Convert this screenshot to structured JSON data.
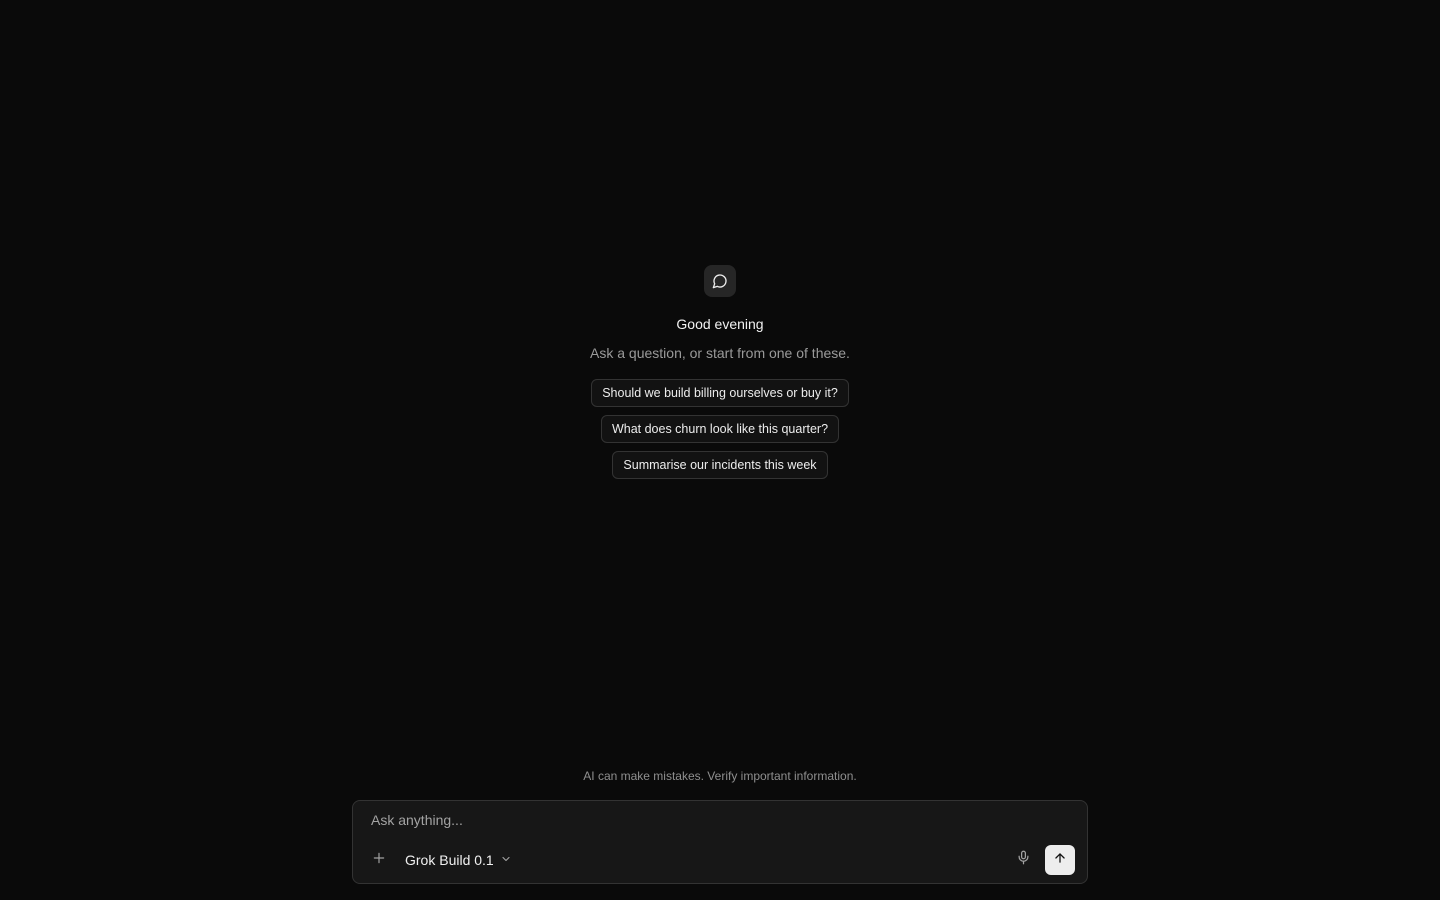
{
  "hero": {
    "icon": "chat-bubble-icon",
    "greeting": "Good evening",
    "subtitle": "Ask a question, or start from one of these."
  },
  "suggestions": [
    {
      "label": "Should we build billing ourselves or buy it?"
    },
    {
      "label": "What does churn look like this quarter?"
    },
    {
      "label": "Summarise our incidents this week"
    }
  ],
  "disclaimer": "AI can make mistakes. Verify important information.",
  "composer": {
    "placeholder": "Ask anything...",
    "value": "",
    "add_icon": "plus-icon",
    "model_label": "Grok Build 0.1",
    "model_dropdown_icon": "chevron-down-icon",
    "mic_icon": "microphone-icon",
    "send_icon": "arrow-up-icon"
  },
  "colors": {
    "background": "#0a0a0a",
    "surface": "#171717",
    "border": "#333333",
    "muted_text": "#9a9a9a",
    "send_button": "#ededed"
  }
}
